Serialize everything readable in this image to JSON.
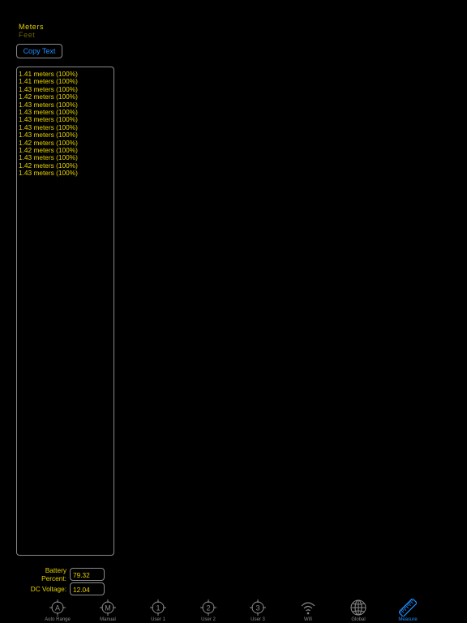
{
  "units": {
    "selected": "Meters",
    "other": "Feet"
  },
  "copy_button": "Copy Text",
  "log_lines": [
    "1.41 meters (100%)",
    "1.41 meters (100%)",
    "1.43 meters (100%)",
    "1.42 meters (100%)",
    "1.43 meters (100%)",
    "1.43 meters (100%)",
    "1.43 meters (100%)",
    "1.43 meters (100%)",
    "1.43 meters (100%)",
    "1.42 meters (100%)",
    "1.42 meters (100%)",
    "1.43 meters (100%)",
    "1.42 meters (100%)",
    "1.43 meters (100%)"
  ],
  "battery": {
    "label": "Battery Percent:",
    "value": "79.32"
  },
  "voltage": {
    "label": "DC Voltage:",
    "value": "12.04"
  },
  "tabs": [
    {
      "label": "Auto Range",
      "icon": "auto-range-icon",
      "glyph": "A"
    },
    {
      "label": "Manual",
      "icon": "manual-icon",
      "glyph": "M"
    },
    {
      "label": "User 1",
      "icon": "user-1-icon",
      "glyph": "1"
    },
    {
      "label": "User 2",
      "icon": "user-2-icon",
      "glyph": "2"
    },
    {
      "label": "User 3",
      "icon": "user-3-icon",
      "glyph": "3"
    },
    {
      "label": "Wifi",
      "icon": "wifi-icon"
    },
    {
      "label": "Global",
      "icon": "globe-icon"
    },
    {
      "label": "Measure",
      "icon": "ruler-icon",
      "active": true
    }
  ],
  "colors": {
    "text": "#e6d200",
    "accent": "#1f8fff",
    "inactive": "#8a8a8a",
    "background": "#000000"
  }
}
